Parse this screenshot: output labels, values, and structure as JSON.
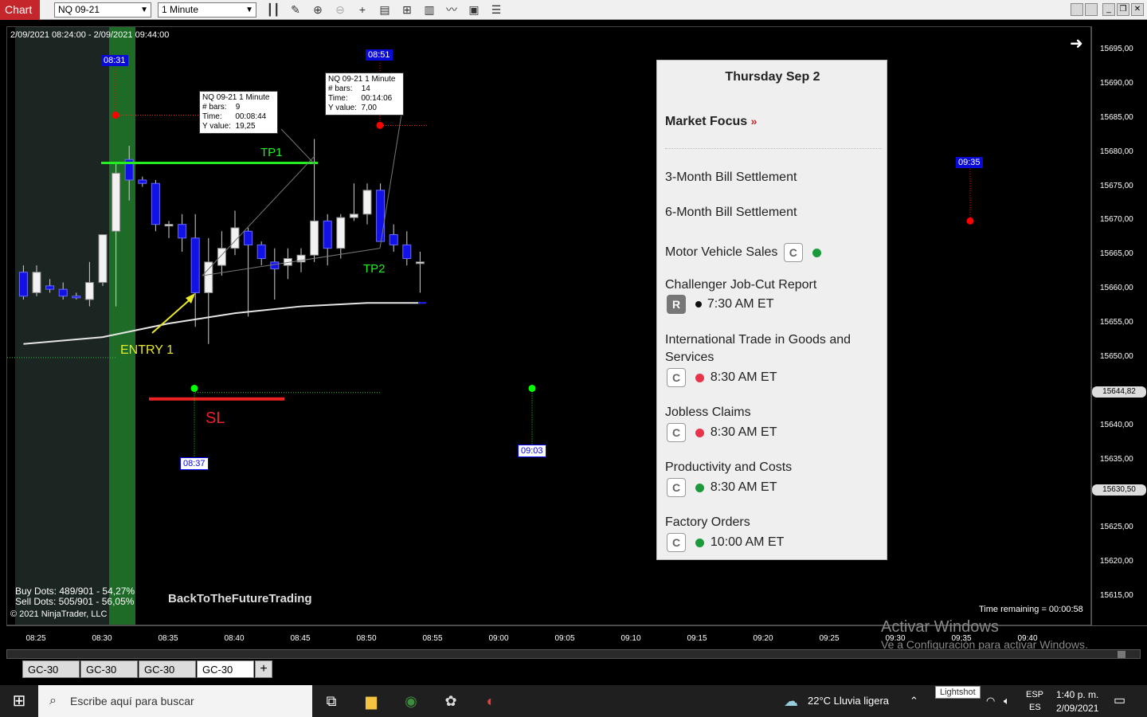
{
  "toolbar": {
    "chart_label": "Chart",
    "instrument": "NQ 09-21",
    "interval": "1 Minute"
  },
  "chart": {
    "range": "2/09/2021 08:24:00 - 2/09/2021 09:44:00",
    "price_ticks": [
      "15695,00",
      "15690,00",
      "15685,00",
      "15680,00",
      "15675,00",
      "15670,00",
      "15665,00",
      "15660,00",
      "15655,00",
      "15650,00",
      "15640,00",
      "15635,00",
      "15625,00",
      "15620,00",
      "15615,00"
    ],
    "price_boxes": [
      "15644,82",
      "15630,50"
    ],
    "time_ticks": [
      "08:25",
      "08:30",
      "08:35",
      "08:40",
      "08:45",
      "08:50",
      "08:55",
      "09:00",
      "09:05",
      "09:10",
      "09:15",
      "09:20",
      "09:25",
      "09:30",
      "09:35",
      "09:40"
    ],
    "labels": {
      "tp1": "TP1",
      "tp2": "TP2",
      "entry": "ENTRY 1",
      "sl": "SL"
    },
    "time_markers": {
      "m0831": "08:31",
      "m0851": "08:51",
      "m0837": "08:37",
      "m0903": "09:03",
      "m0935": "09:35"
    },
    "info1": {
      "title": "NQ 09-21 1 Minute",
      "bars_label": "# bars:",
      "bars": "9",
      "time_label": "Time:",
      "time": "00:08:44",
      "y_label": "Y value:",
      "y": "19,25"
    },
    "info2": {
      "title": "NQ 09-21 1 Minute",
      "bars_label": "# bars:",
      "bars": "14",
      "time_label": "Time:",
      "time": "00:14:06",
      "y_label": "Y value:",
      "y": "7,00"
    },
    "buy_dots": "Buy Dots: 489/901 - 54,27%",
    "sell_dots": "Sell Dots: 505/901 - 56,05%",
    "copyright": "© 2021 NinjaTrader, LLC",
    "watermark": "BackToTheFutureTrading",
    "time_remaining": "Time remaining = 00:00:58",
    "activate_title": "Activar Windows",
    "activate_sub": "Ve a Configuración para activar Windows."
  },
  "panel": {
    "date": "Thursday Sep 2",
    "focus": "Market Focus",
    "focus_chevron": "»",
    "events": [
      {
        "name": "3-Month Bill Settlement"
      },
      {
        "name": "6-Month Bill Settlement"
      },
      {
        "name": "Motor Vehicle Sales",
        "badge": "C",
        "dot": "#1a9a3a"
      },
      {
        "name": "Challenger Job-Cut Report",
        "badge": "R",
        "dot": "#111111",
        "time": "7:30 AM ET"
      },
      {
        "name": "International Trade in Goods and",
        "name2": "Services",
        "badge": "C",
        "dot": "#e8334a",
        "time": "8:30 AM ET"
      },
      {
        "name": "Jobless Claims",
        "badge": "C",
        "dot": "#e8334a",
        "time": "8:30 AM ET"
      },
      {
        "name": "Productivity and Costs",
        "badge": "C",
        "dot": "#1a9a3a",
        "time": "8:30 AM ET"
      },
      {
        "name": "Factory Orders",
        "badge": "C",
        "dot": "#1a9a3a",
        "time": "10:00 AM ET"
      }
    ]
  },
  "tabs": [
    "GC-30",
    "GC-30",
    "GC-30",
    "GC-30"
  ],
  "tab_add": "+",
  "taskbar": {
    "search_placeholder": "Escribe aquí para buscar",
    "weather": "22°C  Lluvia ligera",
    "lightshot": "Lightshot",
    "lang1": "ESP",
    "lang2": "ES",
    "time": "1:40 p. m.",
    "date": "2/09/2021"
  },
  "chart_data": {
    "type": "candlestick",
    "candles": [
      {
        "t": "08:24",
        "o": 15662.5,
        "h": 15663.5,
        "l": 15658.5,
        "c": 15659.0
      },
      {
        "t": "08:25",
        "o": 15659.5,
        "h": 15663.5,
        "l": 15659.0,
        "c": 15662.5
      },
      {
        "t": "08:26",
        "o": 15660.5,
        "h": 15661.5,
        "l": 15659.5,
        "c": 15660.0
      },
      {
        "t": "08:27",
        "o": 15660.0,
        "h": 15661.0,
        "l": 15658.5,
        "c": 15659.0
      },
      {
        "t": "08:28",
        "o": 15659.0,
        "h": 15659.5,
        "l": 15658.5,
        "c": 15658.75
      },
      {
        "t": "08:29",
        "o": 15658.5,
        "h": 15664.0,
        "l": 15657.5,
        "c": 15661.0
      },
      {
        "t": "08:30",
        "o": 15661.0,
        "h": 15668.0,
        "l": 15660.5,
        "c": 15668.0
      },
      {
        "t": "08:31",
        "o": 15668.5,
        "h": 15678.5,
        "l": 15657.5,
        "c": 15677.0
      },
      {
        "t": "08:32",
        "o": 15679.0,
        "h": 15681.0,
        "l": 15673.0,
        "c": 15676.0
      },
      {
        "t": "08:33",
        "o": 15676.0,
        "h": 15676.5,
        "l": 15675.0,
        "c": 15675.5
      },
      {
        "t": "08:34",
        "o": 15675.5,
        "h": 15676.0,
        "l": 15668.5,
        "c": 15669.5
      },
      {
        "t": "08:35",
        "o": 15669.5,
        "h": 15670.0,
        "l": 15667.5,
        "c": 15669.5
      },
      {
        "t": "08:36",
        "o": 15669.5,
        "h": 15671.0,
        "l": 15665.5,
        "c": 15667.5
      },
      {
        "t": "08:37",
        "o": 15667.5,
        "h": 15671.0,
        "l": 15654.5,
        "c": 15659.5
      },
      {
        "t": "08:38",
        "o": 15659.5,
        "h": 15667.5,
        "l": 15652.0,
        "c": 15664.0
      },
      {
        "t": "08:39",
        "o": 15663.5,
        "h": 15668.5,
        "l": 15662.0,
        "c": 15666.0
      },
      {
        "t": "08:40",
        "o": 15666.0,
        "h": 15671.5,
        "l": 15665.0,
        "c": 15669.0
      },
      {
        "t": "08:41",
        "o": 15668.5,
        "h": 15669.0,
        "l": 15656.0,
        "c": 15666.5
      },
      {
        "t": "08:42",
        "o": 15666.5,
        "h": 15667.0,
        "l": 15663.5,
        "c": 15664.5
      },
      {
        "t": "08:43",
        "o": 15664.0,
        "h": 15666.0,
        "l": 15658.5,
        "c": 15663.0
      },
      {
        "t": "08:44",
        "o": 15663.5,
        "h": 15666.0,
        "l": 15661.5,
        "c": 15664.5
      },
      {
        "t": "08:45",
        "o": 15664.0,
        "h": 15666.0,
        "l": 15662.5,
        "c": 15665.0
      },
      {
        "t": "08:46",
        "o": 15665.0,
        "h": 15682.0,
        "l": 15664.0,
        "c": 15670.0
      },
      {
        "t": "08:47",
        "o": 15670.0,
        "h": 15671.0,
        "l": 15663.5,
        "c": 15666.0
      },
      {
        "t": "08:48",
        "o": 15666.0,
        "h": 15671.0,
        "l": 15664.5,
        "c": 15670.5
      },
      {
        "t": "08:49",
        "o": 15670.5,
        "h": 15675.5,
        "l": 15670.0,
        "c": 15671.0
      },
      {
        "t": "08:50",
        "o": 15671.0,
        "h": 15675.5,
        "l": 15669.5,
        "c": 15674.5
      },
      {
        "t": "08:51",
        "o": 15674.5,
        "h": 15675.5,
        "l": 15667.5,
        "c": 15667.0
      },
      {
        "t": "08:52",
        "o": 15668.0,
        "h": 15669.5,
        "l": 15665.5,
        "c": 15666.5
      },
      {
        "t": "08:53",
        "o": 15666.5,
        "h": 15668.5,
        "l": 15663.5,
        "c": 15664.5
      },
      {
        "t": "08:54",
        "o": 15664.0,
        "h": 15665.5,
        "l": 15659.5,
        "c": 15664.0
      }
    ],
    "moving_average": [
      {
        "t": "08:24",
        "v": 15652.0
      },
      {
        "t": "08:30",
        "v": 15653.0
      },
      {
        "t": "08:35",
        "v": 15655.0
      },
      {
        "t": "08:40",
        "v": 15656.5
      },
      {
        "t": "08:45",
        "v": 15657.5
      },
      {
        "t": "08:50",
        "v": 15658.0
      },
      {
        "t": "08:54",
        "v": 15658.0
      }
    ],
    "levels": {
      "tp1": 15678.5,
      "tp2": 15663.5,
      "sl": 15645.0,
      "entry_ref": 15650.0
    },
    "markers": [
      {
        "label": "08:31",
        "price": 15685.5,
        "color": "#ff0000"
      },
      {
        "label": "08:51",
        "price": 15684.0,
        "color": "#ff0000"
      },
      {
        "label": "08:37",
        "price": 15645.5,
        "color": "#00ff00"
      },
      {
        "label": "09:03",
        "price": 15645.5,
        "color": "#00ff00"
      },
      {
        "label": "09:35",
        "price": 15670.0,
        "color": "#ff0000"
      }
    ],
    "xlim": [
      "08:24",
      "09:44"
    ],
    "ylim": [
      15612.0,
      15697.0
    ]
  }
}
